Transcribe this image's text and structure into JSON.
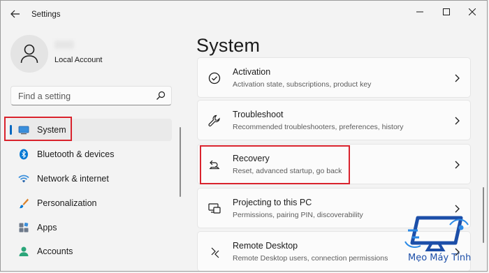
{
  "window": {
    "title": "Settings"
  },
  "profile": {
    "account_type": "Local Account"
  },
  "search": {
    "placeholder": "Find a setting"
  },
  "nav": {
    "items": [
      {
        "label": "System",
        "icon": "monitor-icon",
        "selected": true
      },
      {
        "label": "Bluetooth & devices",
        "icon": "bluetooth-icon"
      },
      {
        "label": "Network & internet",
        "icon": "wifi-icon"
      },
      {
        "label": "Personalization",
        "icon": "paintbrush-icon"
      },
      {
        "label": "Apps",
        "icon": "apps-icon"
      },
      {
        "label": "Accounts",
        "icon": "person-icon"
      }
    ]
  },
  "main": {
    "title": "System",
    "cards": [
      {
        "title": "Activation",
        "subtitle": "Activation state, subscriptions, product key",
        "icon": "check-circle-icon"
      },
      {
        "title": "Troubleshoot",
        "subtitle": "Recommended troubleshooters, preferences, history",
        "icon": "wrench-icon"
      },
      {
        "title": "Recovery",
        "subtitle": "Reset, advanced startup, go back",
        "icon": "recovery-icon"
      },
      {
        "title": "Projecting to this PC",
        "subtitle": "Permissions, pairing PIN, discoverability",
        "icon": "projector-icon"
      },
      {
        "title": "Remote Desktop",
        "subtitle": "Remote Desktop users, connection permissions",
        "icon": "remote-desktop-icon"
      }
    ]
  },
  "watermark": {
    "text": "Mẹo Máy Tính"
  },
  "colors": {
    "accent": "#0067c0",
    "annotation": "#d9232d",
    "watermark": "#1c4ea8"
  }
}
